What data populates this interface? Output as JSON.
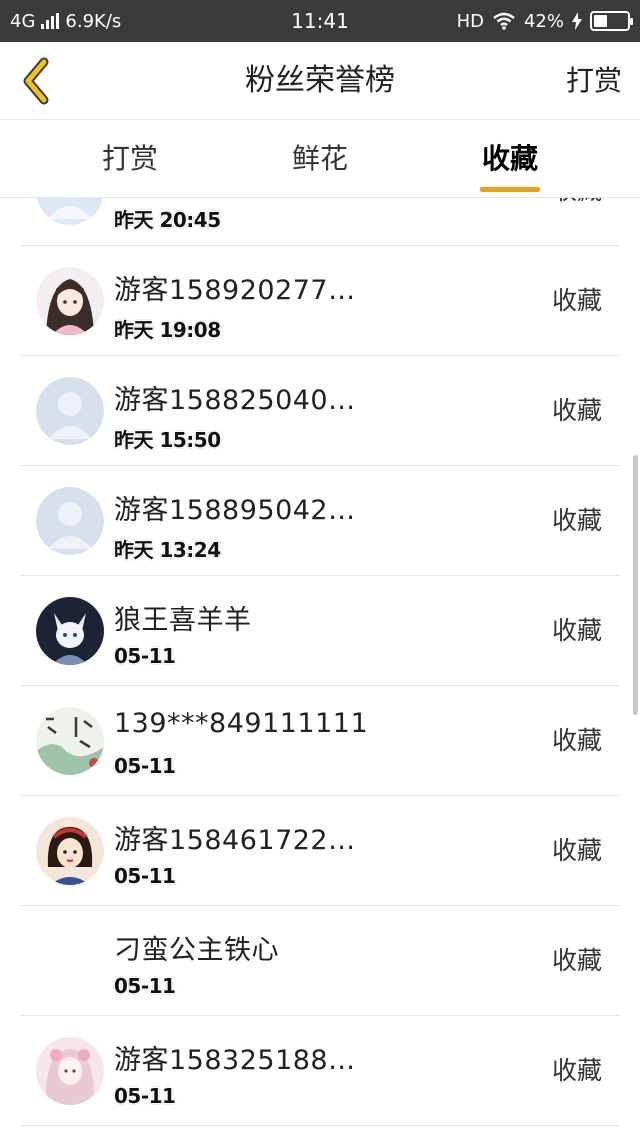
{
  "status_bar": {
    "network": "4G",
    "speed": "6.9K/s",
    "time": "11:41",
    "hd": "HD",
    "battery": "42%",
    "battery_level": 0.42
  },
  "header": {
    "back_icon": "chevron-left-icon",
    "title": "粉丝荣誉榜",
    "action": "打赏",
    "accent": "#e8a317"
  },
  "tabs": [
    {
      "label": "打赏",
      "active": false
    },
    {
      "label": "鲜花",
      "active": false
    },
    {
      "label": "收藏",
      "active": true
    }
  ],
  "list": [
    {
      "name": "",
      "time": "昨天 20:45",
      "action": "收藏",
      "avatar": "default"
    },
    {
      "name": "游客158920277…",
      "time": "昨天 19:08",
      "action": "收藏",
      "avatar": "girl"
    },
    {
      "name": "游客158825040…",
      "time": "昨天 15:50",
      "action": "收藏",
      "avatar": "default"
    },
    {
      "name": "游客158895042…",
      "time": "昨天 13:24",
      "action": "收藏",
      "avatar": "default"
    },
    {
      "name": "狼王喜羊羊",
      "time": "05-11",
      "action": "收藏",
      "avatar": "wolf"
    },
    {
      "name": "139***849111111",
      "time": "05-11",
      "action": "收藏",
      "avatar": "calligraphy"
    },
    {
      "name": "游客158461722…",
      "time": "05-11",
      "action": "收藏",
      "avatar": "princess"
    },
    {
      "name": "刁蛮公主铁心",
      "time": "05-11",
      "action": "收藏",
      "avatar": "none"
    },
    {
      "name": "游客158325188…",
      "time": "05-11",
      "action": "收藏",
      "avatar": "pink"
    }
  ]
}
